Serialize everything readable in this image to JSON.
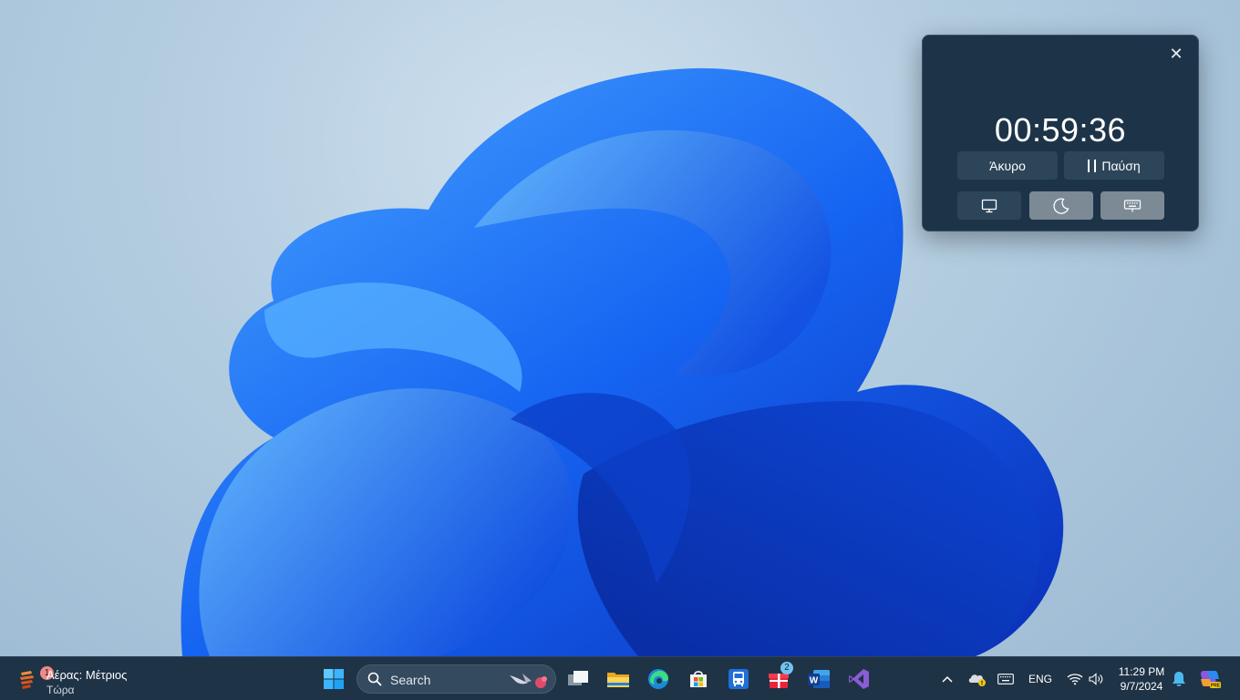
{
  "timer_widget": {
    "close_icon": "close-icon",
    "time": "00:59:36",
    "cancel_label": "Άκυρο",
    "pause_label": "Παύση",
    "modes": [
      {
        "icon": "monitor-icon",
        "active": false
      },
      {
        "icon": "moon-icon",
        "active": true
      },
      {
        "icon": "keyboard-icon",
        "active": true
      }
    ]
  },
  "taskbar": {
    "weather": {
      "title": "Αέρας: Μέτριος",
      "subtitle": "Τώρα",
      "badge": "1",
      "icon": "air-quality-icon"
    },
    "search": {
      "placeholder": "Search"
    },
    "apps": [
      {
        "name": "task-view",
        "icon": "task-view-icon"
      },
      {
        "name": "file-explorer",
        "icon": "folder-icon"
      },
      {
        "name": "edge",
        "icon": "edge-icon"
      },
      {
        "name": "microsoft-store",
        "icon": "store-icon"
      },
      {
        "name": "transit",
        "icon": "bus-icon"
      },
      {
        "name": "gift",
        "icon": "gift-icon",
        "badge": "2"
      },
      {
        "name": "word",
        "icon": "word-icon"
      },
      {
        "name": "visual-studio",
        "icon": "visual-studio-icon"
      }
    ],
    "tray": {
      "language": "ENG",
      "time": "11:29 PM",
      "date": "9/7/2024"
    }
  },
  "colors": {
    "taskbar": "#1f3346",
    "timer_bg": "#1d3448",
    "button_bg": "#2c4559",
    "active_mode": "#7c8a96",
    "accent_blue": "#0a5cf0"
  }
}
